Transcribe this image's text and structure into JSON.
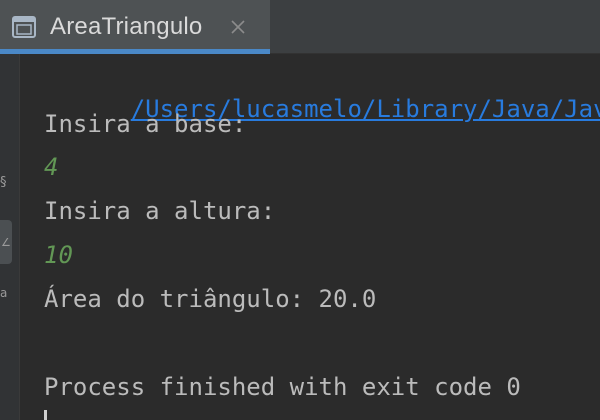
{
  "tab": {
    "title": "AreaTriangulo",
    "icon": "console-window-icon",
    "close_icon": "close-icon"
  },
  "console": {
    "path_line": "/Users/lucasmelo/Library/Java/JavaVi",
    "prompt_base": "Insira a base:",
    "input_base": "4",
    "prompt_altura": "Insira a altura:",
    "input_altura": "10",
    "result": "Área do triângulo: 20.0",
    "exit_message": "Process finished with exit code 0"
  },
  "colors": {
    "background": "#2b2b2b",
    "tab_active": "#4e5254",
    "tab_underline": "#4a88c7",
    "link": "#287bde",
    "user_input": "#629755",
    "output_text": "#bbbbbb"
  }
}
